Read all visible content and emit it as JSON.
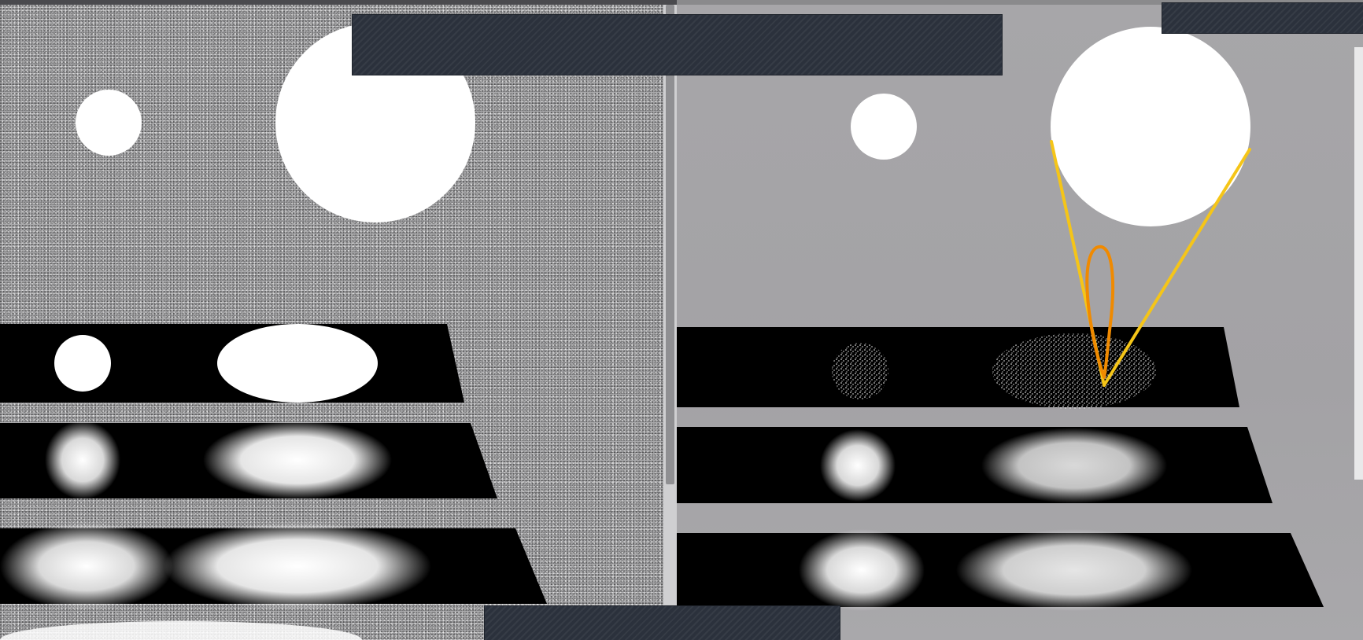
{
  "screen": {
    "description_panels": [
      "left-noisy-render",
      "right-denoised-render"
    ]
  },
  "colors": {
    "background_gray": "#a8a8aa",
    "strip_black": "#000000",
    "sphere_white": "#ffffff",
    "annotation_yellow": "#f5c518",
    "annotation_orange": "#f08a00",
    "redaction": "#2b313c"
  },
  "annotations": {
    "cone_lines": "yellow-lines",
    "lobe_shape": "orange-lobe"
  }
}
